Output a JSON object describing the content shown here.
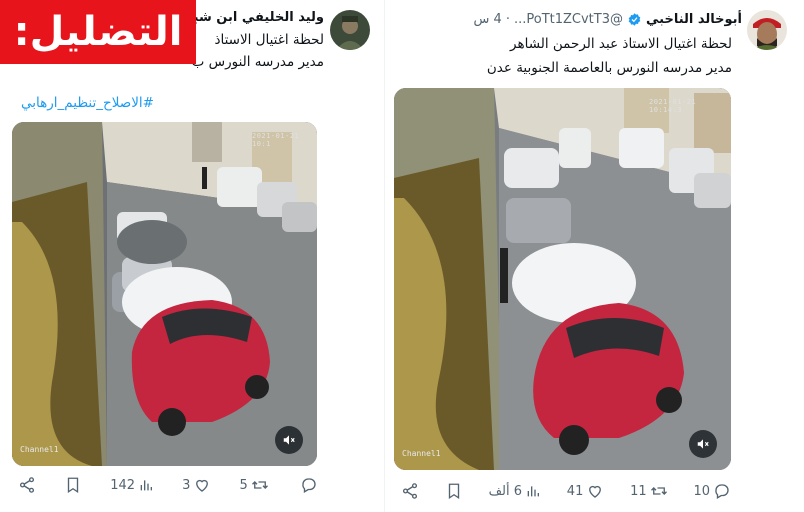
{
  "label": {
    "text": "التضليل:",
    "color": "#e8141b"
  },
  "right_tweet": {
    "display_name": "أبوخالد الناخبي",
    "handle": "@PoTt1ZCvtT3...",
    "time": "4 س",
    "text_line1": "لحظة اغتيال الاستاذ عبد الرحمن الشاهر",
    "text_line2": "مدير مدرسه النورس بالعاصمة الجنوبية عدن",
    "media_watermark": "Channel1",
    "media_timestamp": "2021-01-21 10:14:3",
    "actions": {
      "replies": "10",
      "retweets": "11",
      "likes": "41",
      "views": "6 ألف"
    }
  },
  "left_tweet": {
    "display_name": "وليد الخليفي ابن شبو",
    "text_line1": "لحظة اغتيال الاستاذ",
    "text_line2": "مدير مدرسه النورس ب",
    "hashtag": "#الاصلاح_تنظيم_ارهابي",
    "media_watermark": "Channel1",
    "media_timestamp": "2021-01-21 10:1",
    "actions": {
      "replies": "",
      "retweets": "5",
      "likes": "3",
      "views": "142"
    }
  },
  "colors": {
    "accent": "#1d9bf0",
    "muted": "#536471",
    "verified": "#1d9bf0"
  },
  "icons": [
    "share-icon",
    "bookmark-icon",
    "views-icon",
    "like-icon",
    "retweet-icon",
    "reply-icon",
    "mute-icon",
    "verified-icon"
  ]
}
